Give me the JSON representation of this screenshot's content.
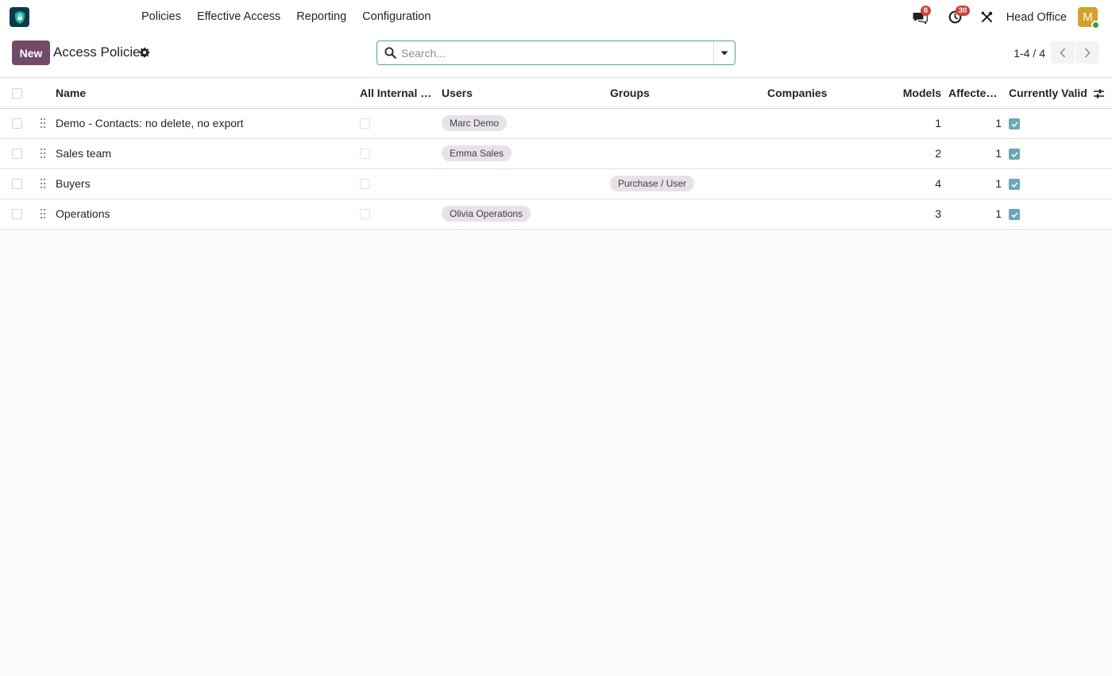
{
  "navbar": {
    "menu": [
      "Policies",
      "Effective Access",
      "Reporting",
      "Configuration"
    ],
    "messages_count": "8",
    "activities_count": "30",
    "company": "Head Office",
    "avatar_letter": "M"
  },
  "control_panel": {
    "new_label": "New",
    "title": "Access Policies",
    "search_placeholder": "Search...",
    "pager": "1-4 / 4"
  },
  "table": {
    "columns": {
      "name": "Name",
      "internal": "All Internal U...",
      "users": "Users",
      "groups": "Groups",
      "companies": "Companies",
      "models": "Models",
      "affected": "Affected ...",
      "valid": "Currently Valid"
    },
    "rows": [
      {
        "name": "Demo - Contacts: no delete, no export",
        "internal": false,
        "users": "Marc Demo",
        "groups": "",
        "companies": "",
        "models": "1",
        "affected": "1",
        "valid": true
      },
      {
        "name": "Sales team",
        "internal": false,
        "users": "Emma Sales",
        "groups": "",
        "companies": "",
        "models": "2",
        "affected": "1",
        "valid": true
      },
      {
        "name": "Buyers",
        "internal": false,
        "users": "",
        "groups": "Purchase / User",
        "companies": "",
        "models": "4",
        "affected": "1",
        "valid": true
      },
      {
        "name": "Operations",
        "internal": false,
        "users": "Olivia Operations",
        "groups": "",
        "companies": "",
        "models": "3",
        "affected": "1",
        "valid": true
      }
    ]
  },
  "colors": {
    "brand": "#714b67",
    "badge": "#d23f3a",
    "check": "#6aa8b3",
    "avatar": "#d4a22c"
  }
}
